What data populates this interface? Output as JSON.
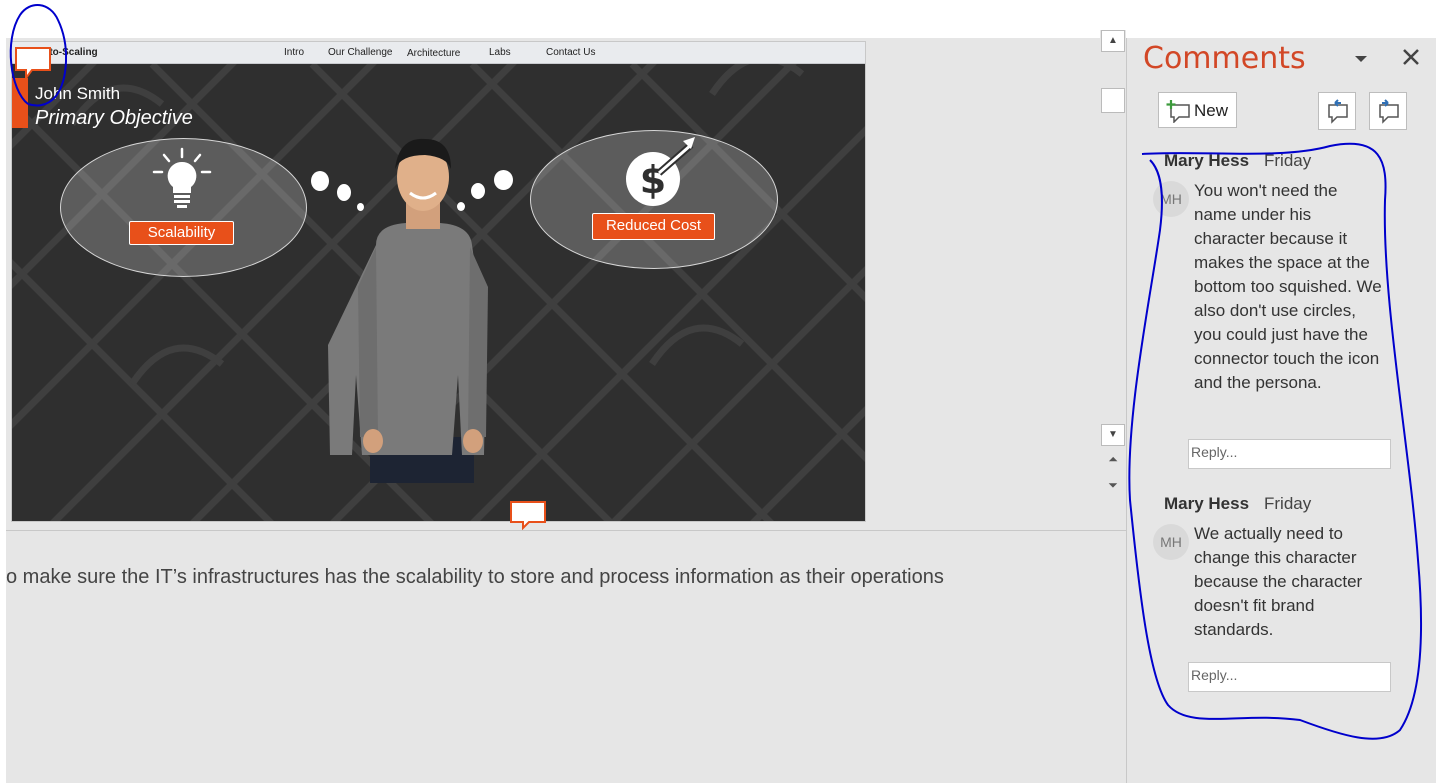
{
  "slide": {
    "nav": {
      "brand": "Auto-Scaling",
      "items": [
        "Intro",
        "Our Challenge",
        "Architecture",
        "Labs",
        "Contact Us"
      ]
    },
    "persona_name": "John Smith",
    "persona_objective": "Primary Objective",
    "left_label": "Scalability",
    "right_label": "Reduced Cost"
  },
  "notes": {
    "text": "o make sure the IT’s infrastructures has the scalability to store and process information as their operations"
  },
  "comments_pane": {
    "title": "Comments",
    "new_label": "New",
    "comments": [
      {
        "author": "Mary Hess",
        "time": "Friday",
        "initials": "MH",
        "body": "You won't need the name under his character because it makes the space at the bottom too squished. We also don't use circles, you could just have the connector touch the icon and the persona.",
        "reply_placeholder": "Reply..."
      },
      {
        "author": "Mary Hess",
        "time": "Friday",
        "initials": "MH",
        "body": "We actually need to change this character because the character doesn't fit brand standards.",
        "reply_placeholder": "Reply..."
      }
    ]
  },
  "colors": {
    "accent": "#e8501a",
    "title": "#d24726",
    "ink": "#0000cc"
  }
}
